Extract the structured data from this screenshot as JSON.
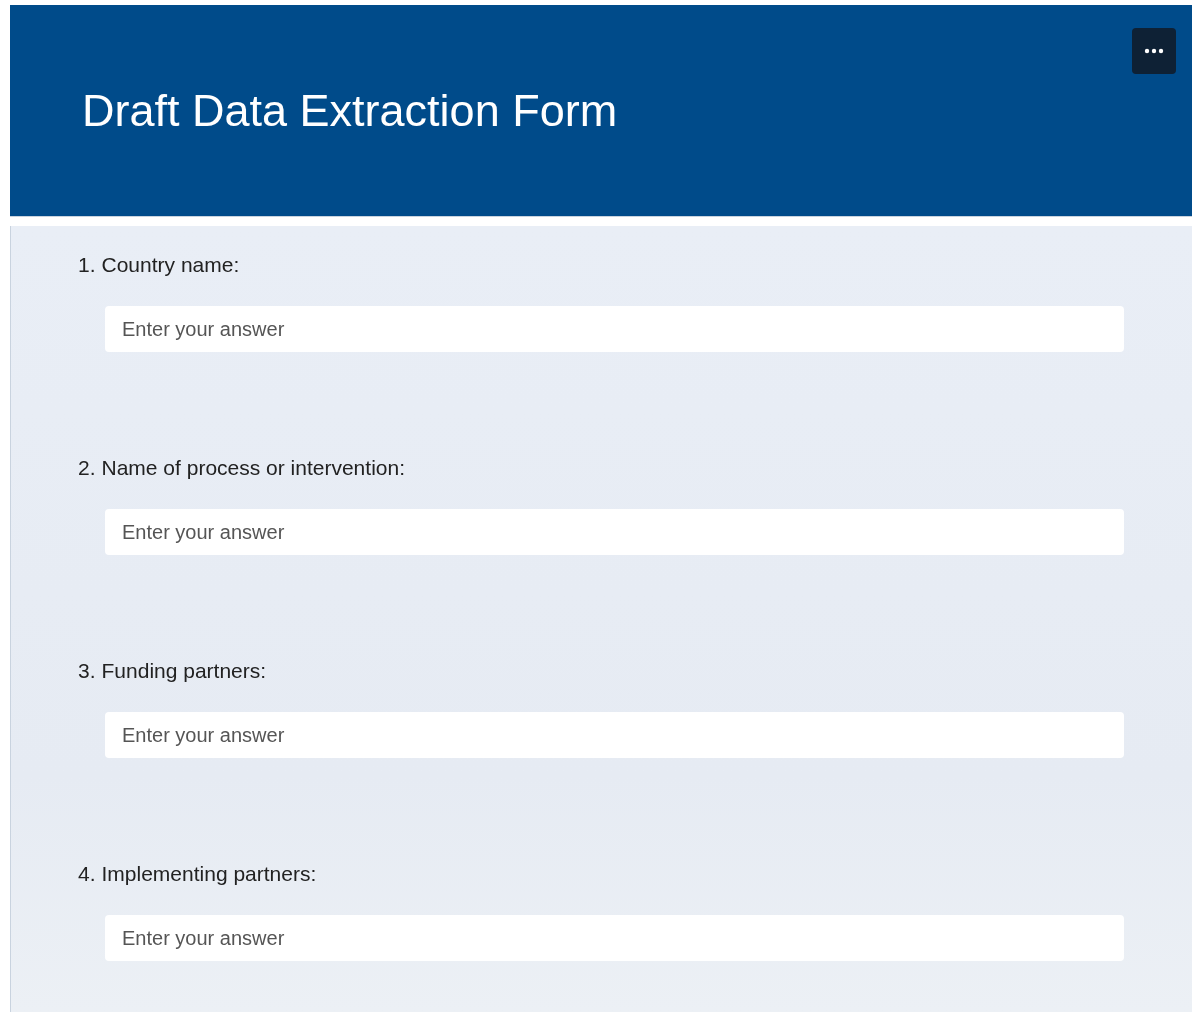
{
  "header": {
    "title": "Draft Data Extraction Form"
  },
  "questions": [
    {
      "number": "1.",
      "label": "Country name:",
      "placeholder": "Enter your answer"
    },
    {
      "number": "2.",
      "label": "Name of process or intervention:",
      "placeholder": "Enter your answer"
    },
    {
      "number": "3.",
      "label": "Funding partners:",
      "placeholder": "Enter your answer"
    },
    {
      "number": "4.",
      "label": "Implementing partners:",
      "placeholder": "Enter your answer"
    }
  ]
}
